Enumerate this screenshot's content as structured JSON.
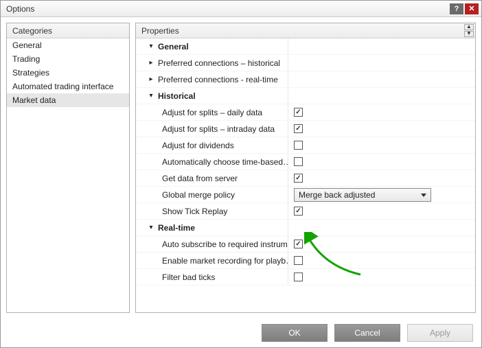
{
  "window": {
    "title": "Options"
  },
  "sidebar": {
    "header": "Categories",
    "items": [
      {
        "label": "General"
      },
      {
        "label": "Trading"
      },
      {
        "label": "Strategies"
      },
      {
        "label": "Automated trading interface"
      },
      {
        "label": "Market data",
        "selected": true
      }
    ]
  },
  "properties": {
    "header": "Properties",
    "groups": {
      "general": {
        "label": "General",
        "items": {
          "pref_hist": "Preferred connections – historical",
          "pref_rt": "Preferred connections - real-time"
        }
      },
      "historical": {
        "label": "Historical",
        "items": {
          "adj_splits_daily": "Adjust for splits – daily data",
          "adj_splits_intra": "Adjust for splits – intraday data",
          "adj_div": "Adjust for dividends",
          "auto_time": "Automatically choose time-based…",
          "get_server": "Get data from server",
          "merge_policy": "Global merge policy",
          "merge_policy_value": "Merge back adjusted",
          "show_tick": "Show Tick Replay"
        }
      },
      "realtime": {
        "label": "Real-time",
        "items": {
          "auto_sub": "Auto subscribe to required instrum…",
          "enable_rec": "Enable market recording for playb…",
          "filter_bad": "Filter bad ticks"
        }
      }
    }
  },
  "buttons": {
    "ok": "OK",
    "cancel": "Cancel",
    "apply": "Apply"
  }
}
